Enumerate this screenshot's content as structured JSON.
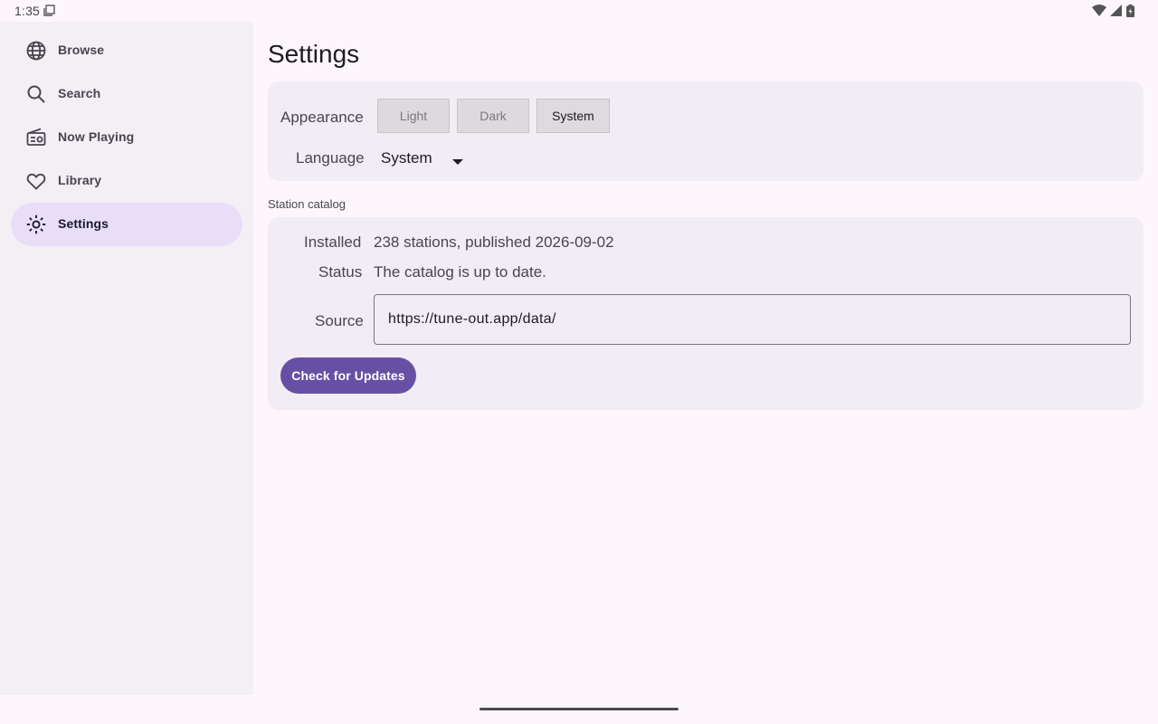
{
  "status_bar": {
    "time": "1:35",
    "left_icon": "screenshot-icon",
    "right_icons": [
      "wifi-icon",
      "cell-signal-icon",
      "battery-icon"
    ]
  },
  "sidebar": {
    "items": [
      {
        "label": "Browse",
        "icon": "globe-icon",
        "active": false
      },
      {
        "label": "Search",
        "icon": "search-icon",
        "active": false
      },
      {
        "label": "Now Playing",
        "icon": "radio-icon",
        "active": false
      },
      {
        "label": "Library",
        "icon": "heart-icon",
        "active": false
      },
      {
        "label": "Settings",
        "icon": "brightness-icon",
        "active": true
      }
    ]
  },
  "main": {
    "title": "Settings",
    "appearance": {
      "label": "Appearance",
      "options": [
        "Light",
        "Dark",
        "System"
      ],
      "selected": "System"
    },
    "language": {
      "label": "Language",
      "value": "System"
    },
    "catalog": {
      "section_label": "Station catalog",
      "installed_label": "Installed",
      "installed_value": "238 stations, published 2026-09-02",
      "status_label": "Status",
      "status_value": "The catalog is up to date.",
      "source_label": "Source",
      "source_value": "https://tune-out.app/data/",
      "check_button": "Check for Updates"
    }
  },
  "colors": {
    "accent": "#6750a4",
    "active_nav": "#e8def8",
    "sidebar_bg": "#f4eff5",
    "page_bg": "#fdf7fd",
    "card_bg": "#f2ecf4"
  }
}
